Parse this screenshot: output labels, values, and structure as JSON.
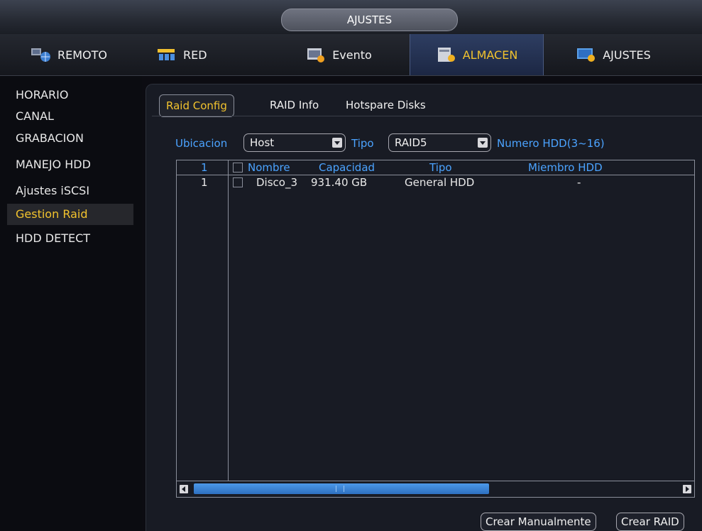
{
  "window": {
    "title": "AJUSTES"
  },
  "topnav": {
    "tabs": [
      {
        "label": "REMOTO",
        "icon": "remote-network-icon"
      },
      {
        "label": "RED",
        "icon": "network-icon"
      },
      {
        "label": "Evento",
        "icon": "event-icon"
      },
      {
        "label": "ALMACEN",
        "icon": "storage-icon",
        "active": true
      },
      {
        "label": "AJUSTES",
        "icon": "settings-icon"
      }
    ]
  },
  "sidebar": {
    "items": [
      {
        "label": "HORARIO"
      },
      {
        "label": "CANAL"
      },
      {
        "label": "GRABACION"
      },
      {
        "label": "MANEJO HDD"
      },
      {
        "label": "Ajustes iSCSI"
      },
      {
        "label": "Gestion Raid",
        "active": true
      },
      {
        "label": "HDD DETECT"
      }
    ]
  },
  "subtabs": [
    {
      "label": "Raid Config",
      "active": true
    },
    {
      "label": "RAID Info"
    },
    {
      "label": "Hotspare Disks"
    }
  ],
  "filters": {
    "location_label": "Ubicacion",
    "location_value": "Host",
    "type_label": "Tipo",
    "type_value": "RAID5",
    "hdd_count_label": "Numero HDD(3~16)"
  },
  "table": {
    "headers": {
      "index": "1",
      "name": "Nombre",
      "capacity": "Capacidad",
      "type": "Tipo",
      "member": "Miembro HDD"
    },
    "rows": [
      {
        "index": "1",
        "name": "Disco_3",
        "capacity": "931.40 GB",
        "type": "General HDD",
        "member": "-"
      }
    ]
  },
  "buttons": {
    "create_manual": "Crear Manualmente",
    "create_raid": "Crear RAID"
  },
  "colors": {
    "accent_yellow": "#f2c32e",
    "label_blue": "#4ba3ff",
    "active_tab_bg": "#2e3e62"
  }
}
